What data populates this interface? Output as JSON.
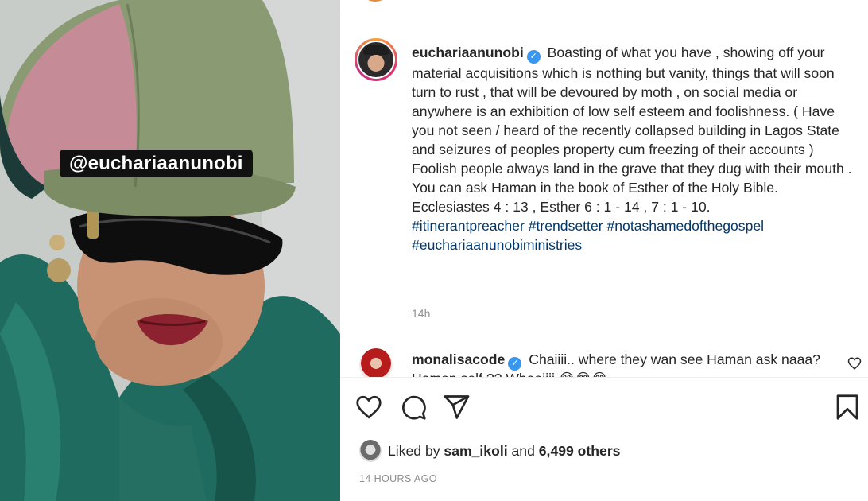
{
  "photo": {
    "tag_text": "@euchariaanunobi"
  },
  "post": {
    "author": "euchariaanunobi",
    "verified_icon": "verified-badge-icon",
    "caption_lines": [
      "Boasting of what you have , showing off your material acquisitions which is nothing but vanity, things that will soon turn to rust , that will be devoured by moth , on social media or anywhere is an exhibition of low self esteem and foolishness. ( Have you not seen / heard of the recently collapsed building in Lagos State and seizures of peoples property cum freezing of their accounts )",
      "Foolish people always land in the grave that they dug with their mouth .",
      "You can ask Haman in the book of Esther of the Holy Bible.",
      "Ecclesiastes 4 : 13 , Esther 6 : 1 - 14 , 7 : 1 - 10."
    ],
    "hashtags_line1": "#itinerantpreacher #trendsetter #notashamedofthegospel",
    "hashtags_line2": "#euchariaanunobiministries",
    "relative_time": "14h"
  },
  "comment": {
    "user": "monalisacode",
    "text": "Chaiiii.. where they wan see Haman ask naaa?",
    "cut_line": "Haman self ?? Whaaiiii 😂😂😂"
  },
  "actions": {
    "like_icon": "heart-icon",
    "comment_icon": "comment-icon",
    "share_icon": "share-icon",
    "save_icon": "bookmark-icon"
  },
  "likes": {
    "prefix": "Liked by",
    "user": "sam_ikoli",
    "middle": "and",
    "others": "6,499 others"
  },
  "timestamp": "14 HOURS AGO",
  "colors": {
    "hashtag": "#00376b",
    "verified": "#3897f0",
    "muted": "#8e8e8e"
  }
}
